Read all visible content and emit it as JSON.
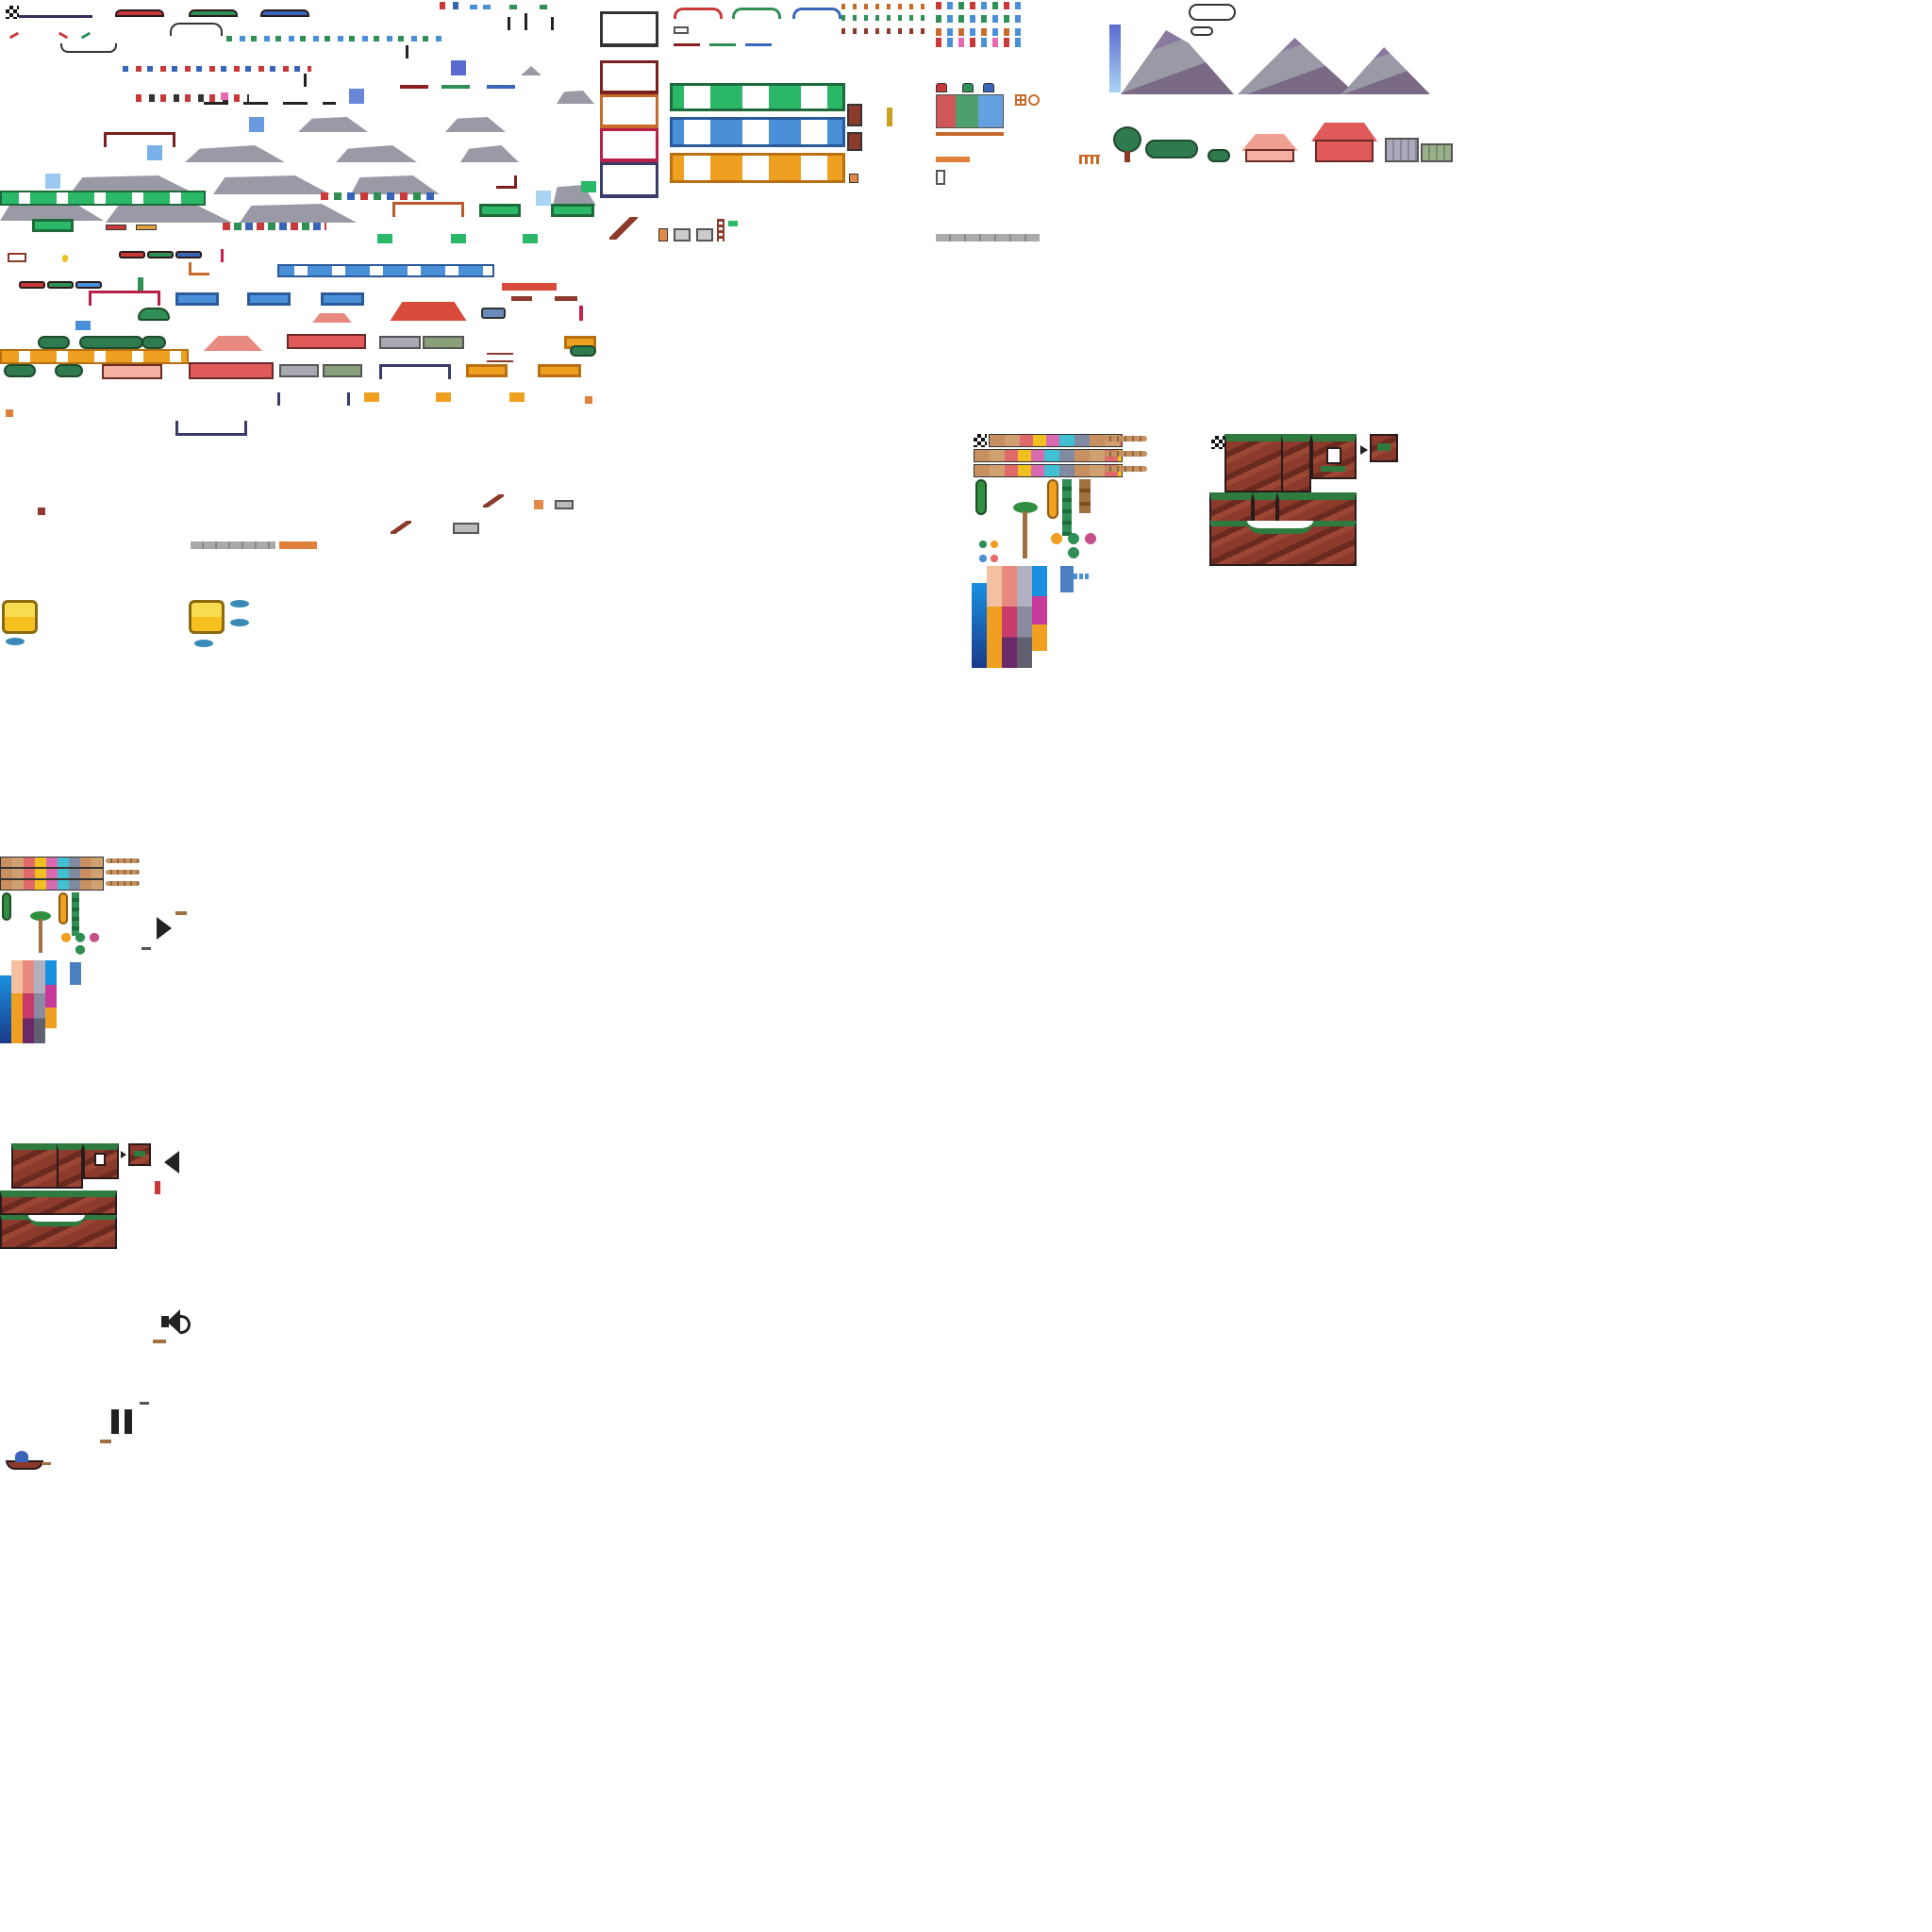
{
  "canvas": {
    "title": "",
    "background": "#ffffff"
  },
  "palette": {
    "red_roof": "#c83a3a",
    "green_roof": "#2f8f55",
    "blue_roof": "#3a64b8",
    "orange_floor": "#f0a020",
    "blue_floor": "#4a90d9",
    "green_floor": "#2bb868",
    "mountain_gray": "#9a9aa6",
    "mountain_purple": "#7a6a86",
    "sky_blue": "#6aa6ea",
    "tree_green": "#2f7a4f",
    "house_pink": "#e88a80",
    "house_red": "#e05a5a",
    "dirt_brown": "#8b3a2b",
    "grass_green": "#2f7a3f",
    "coin_gold": "#f5c020",
    "dark_outline": "#2b1a1a"
  },
  "sheets": {
    "main_sheet": {
      "label": ""
    },
    "rooms_sheet": {
      "label": ""
    },
    "furniture_sheet": {
      "label": ""
    },
    "landscape_sheet": {
      "label": ""
    },
    "tileset_large": {
      "label": ""
    },
    "terrain_large": {
      "label": ""
    },
    "tileset_small": {
      "label": ""
    },
    "terrain_small": {
      "label": ""
    }
  },
  "ui_icons": {
    "play": "play-icon",
    "back": "back-icon",
    "sound": "sound-icon",
    "pause": "pause-icon"
  }
}
